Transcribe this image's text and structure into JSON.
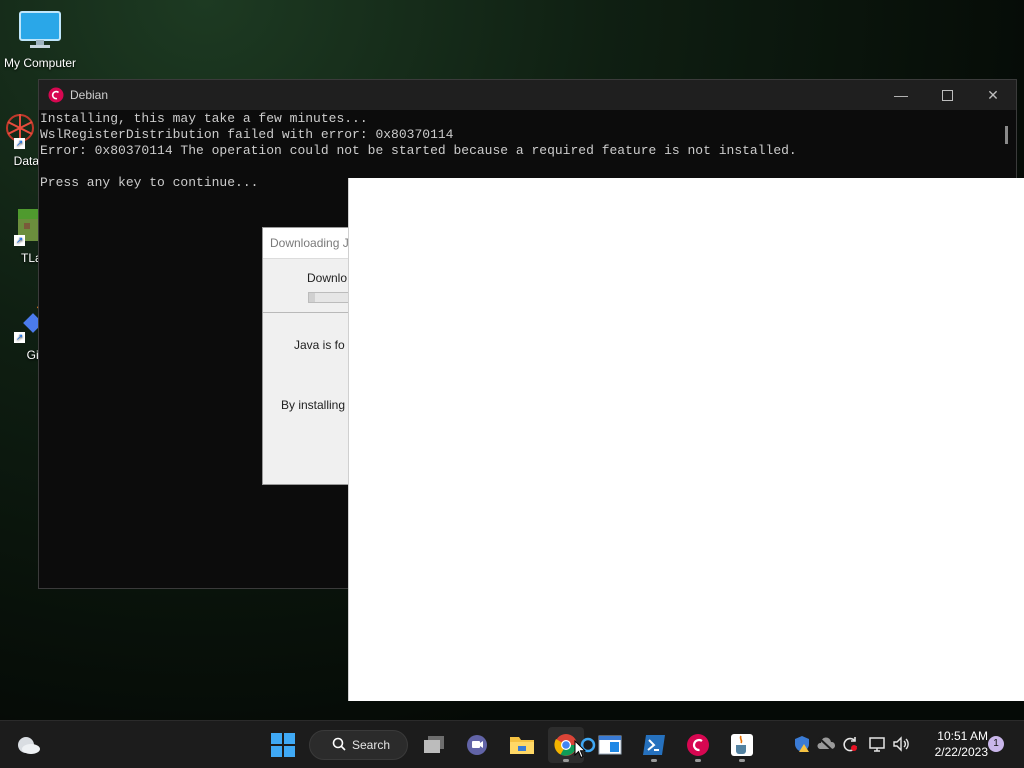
{
  "desktop": {
    "icons": [
      {
        "label": "My Computer",
        "icon": "monitor-icon"
      },
      {
        "label": "DataW",
        "icon": "datawarrior-icon"
      },
      {
        "label": "TLaun",
        "icon": "tlauncher-icon"
      },
      {
        "label": "Git B",
        "icon": "git-bash-icon"
      }
    ]
  },
  "terminal": {
    "title": "Debian",
    "lines": "Installing, this may take a few minutes...\nWslRegisterDistribution failed with error: 0x80370114\nError: 0x80370114 The operation could not be started because a required feature is not installed.\n\nPress any key to continue..."
  },
  "java_dialog": {
    "title": "Downloading J",
    "download_label": "Downlo",
    "progress": 0.05,
    "body_line1": "Java is fo",
    "body_line2": "By installing"
  },
  "taskbar": {
    "search_label": "Search",
    "clock_time": "10:51 AM",
    "clock_date": "2/22/2023",
    "notification_count": "1",
    "apps": [
      "start",
      "search",
      "task-view",
      "teams",
      "file-explorer",
      "chrome",
      "cortana",
      "window-app",
      "powershell",
      "debian",
      "java"
    ]
  },
  "colors": {
    "taskbar_bg": "#1c1c1c",
    "terminal_bg": "#0c0c0c",
    "debian_red": "#d70751",
    "windows_blue": "#3fa9f5"
  }
}
